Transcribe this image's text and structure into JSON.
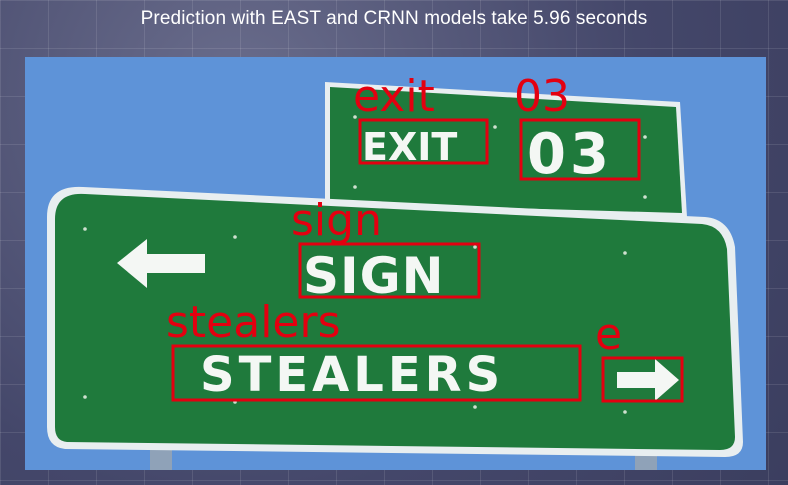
{
  "header": {
    "title": "Prediction with EAST and CRNN models take 5.96 seconds"
  },
  "sign": {
    "exit_text": "EXIT",
    "exit_number": "03",
    "main_text": "SIGN",
    "team_text": "STEALERS"
  },
  "detections": [
    {
      "label": "exit"
    },
    {
      "label": "03"
    },
    {
      "label": "sign"
    },
    {
      "label": "stealers"
    },
    {
      "label": "e"
    }
  ],
  "colors": {
    "sign_green": "#1f7a3c",
    "sky_blue": "#5e93d8",
    "detection_red": "#e30010"
  }
}
